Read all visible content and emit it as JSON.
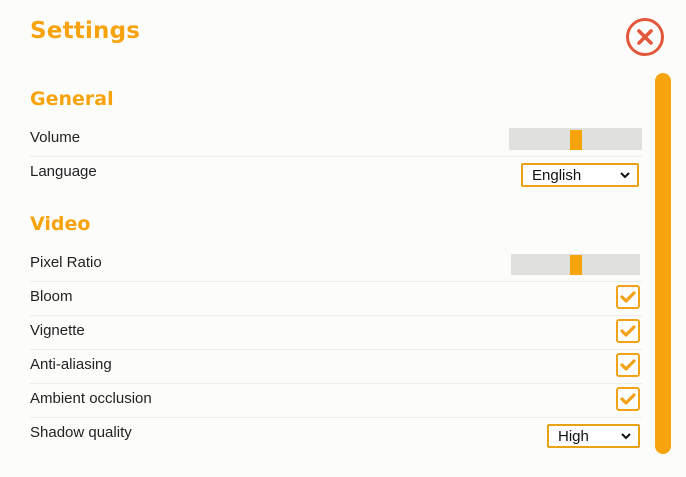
{
  "title": "Settings",
  "close_icon": "close-x-icon",
  "colors": {
    "accent": "#f7a30e",
    "close": "#e2583a",
    "track": "#e0e0de"
  },
  "general": {
    "heading": "General",
    "volume": {
      "label": "Volume",
      "value_fraction": 0.5
    },
    "language": {
      "label": "Language",
      "value": "English"
    }
  },
  "video": {
    "heading": "Video",
    "pixel_ratio": {
      "label": "Pixel Ratio",
      "value_fraction": 0.5
    },
    "bloom": {
      "label": "Bloom",
      "checked": true
    },
    "vignette": {
      "label": "Vignette",
      "checked": true
    },
    "anti_aliasing": {
      "label": "Anti-aliasing",
      "checked": true
    },
    "ambient_occlusion": {
      "label": "Ambient occlusion",
      "checked": true
    },
    "shadow_quality": {
      "label": "Shadow quality",
      "value": "High"
    }
  }
}
